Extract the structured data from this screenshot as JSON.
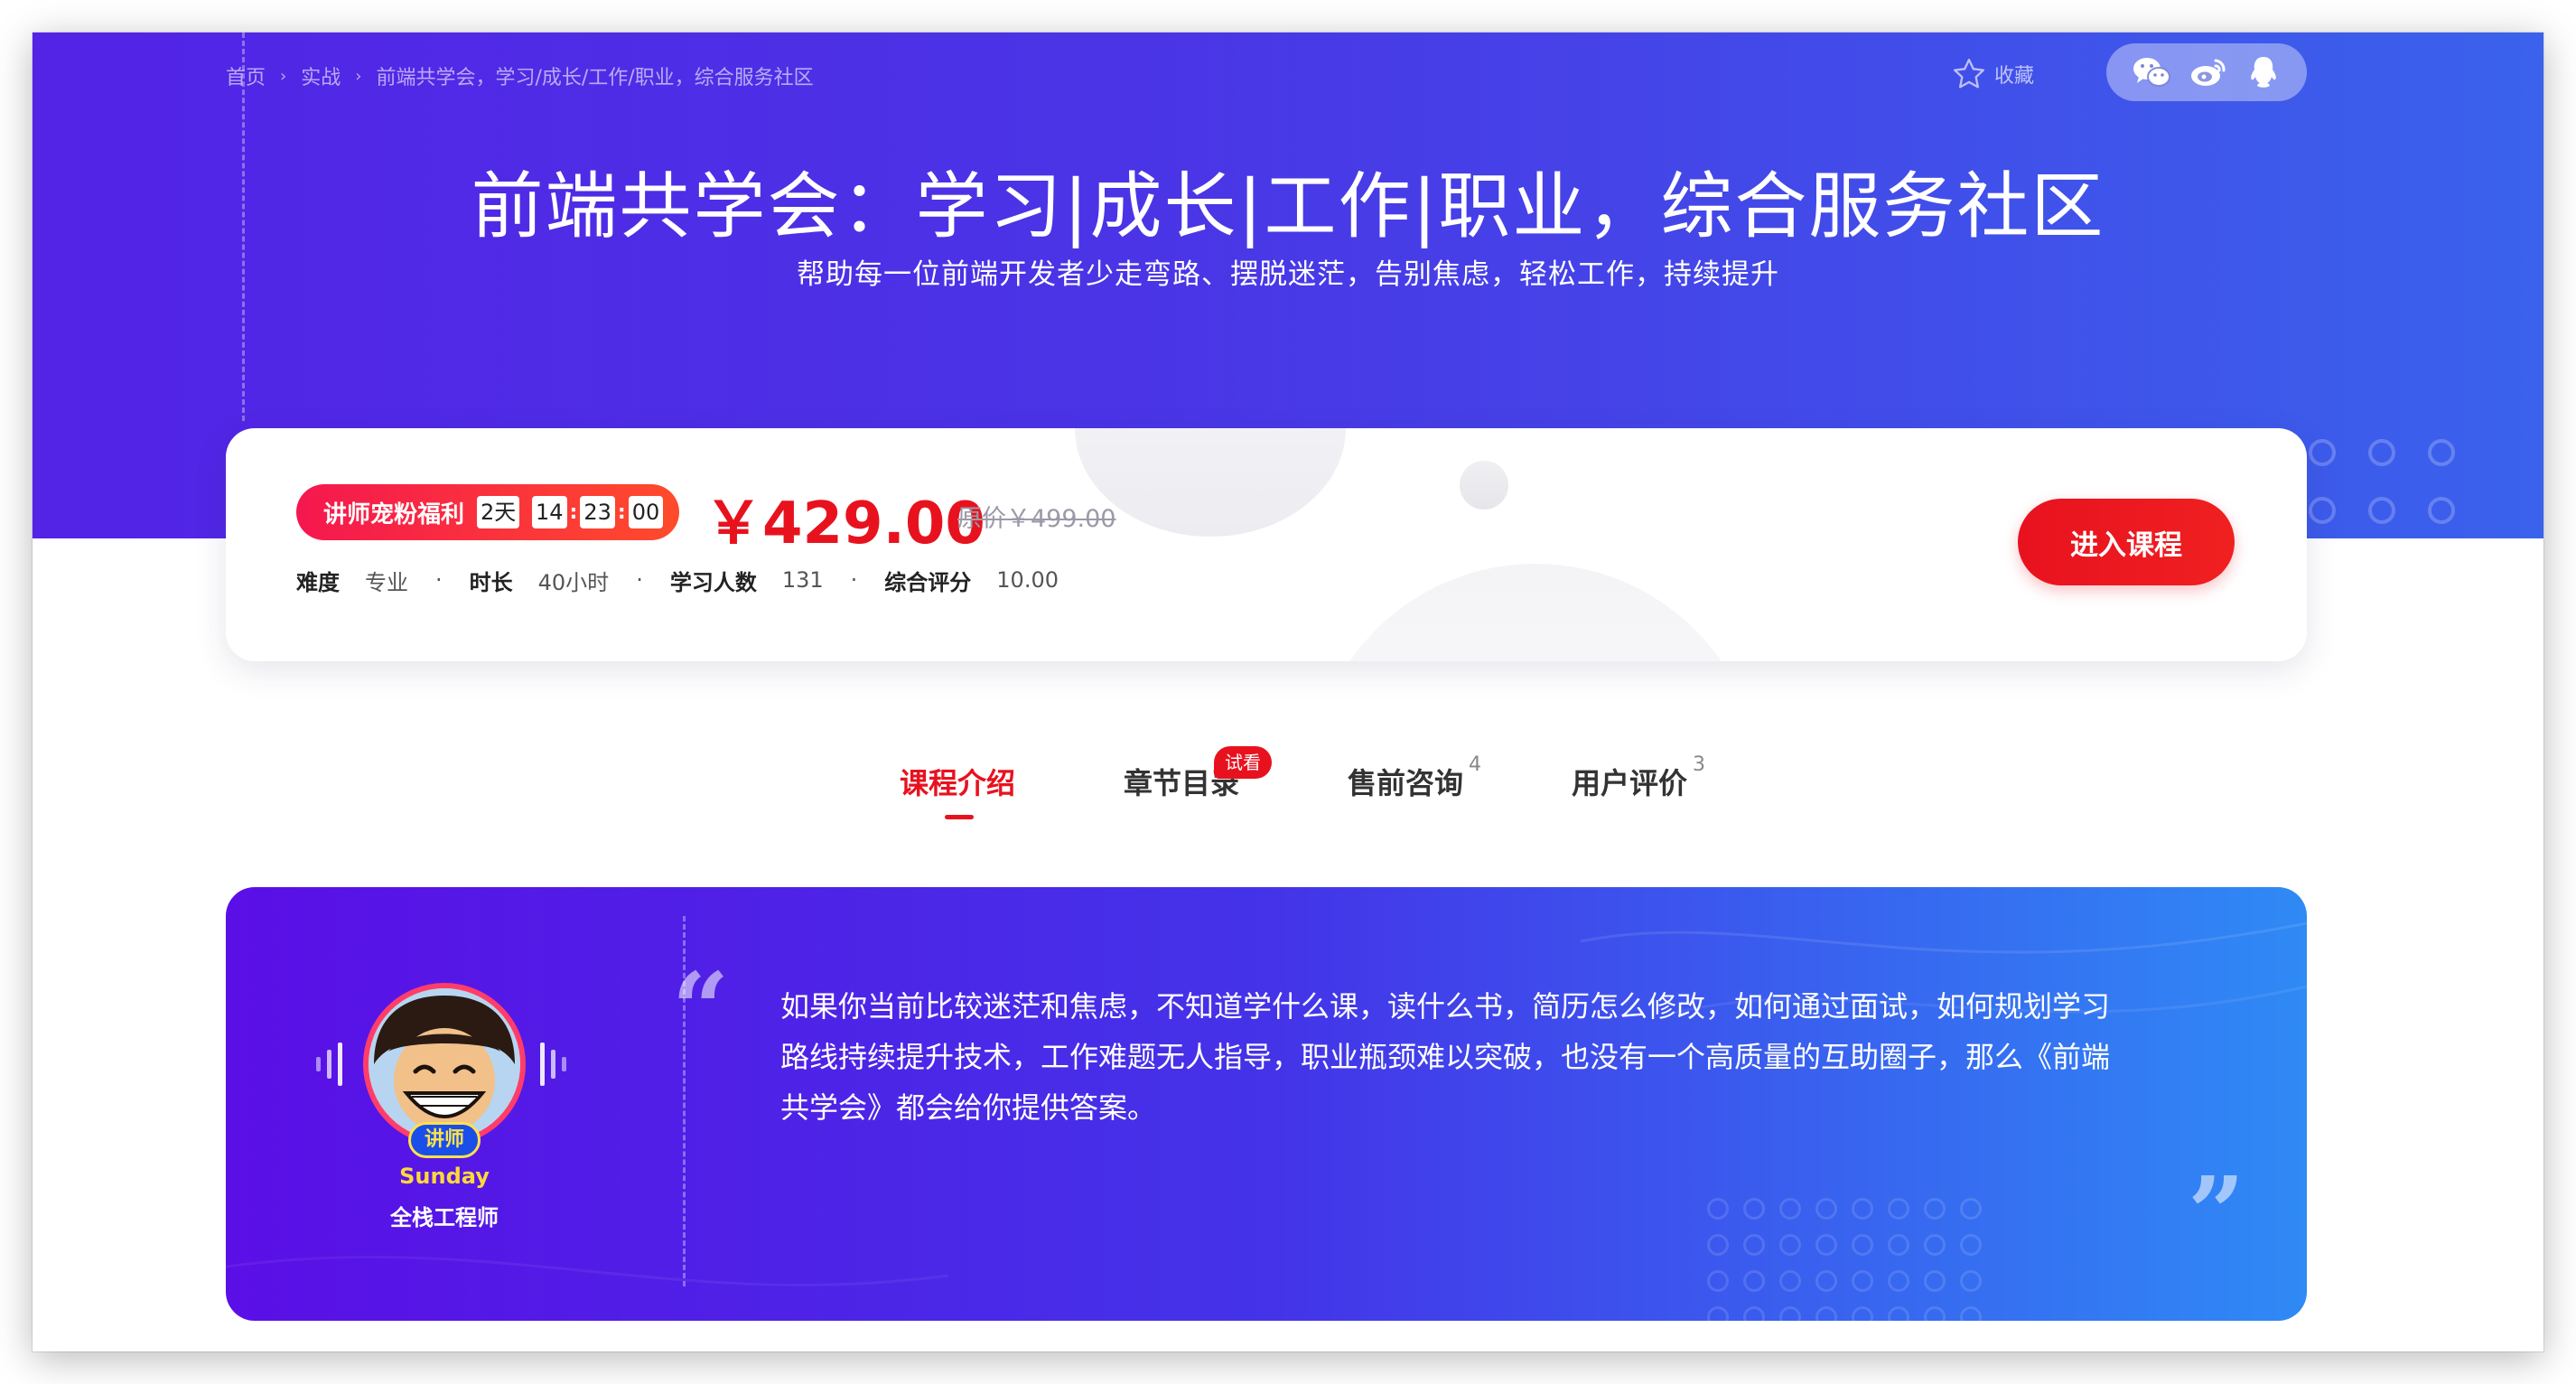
{
  "breadcrumb": {
    "items": [
      "首页",
      "实战",
      "前端共学会，学习/成长/工作/职业，综合服务社区"
    ],
    "separator": "›"
  },
  "header": {
    "favorite_label": "收藏",
    "share_icons": [
      "wechat-icon",
      "weibo-icon",
      "qq-icon"
    ],
    "title": "前端共学会：学习|成长|工作|职业，综合服务社区",
    "subtitle": "帮助每一位前端开发者少走弯路、摆脱迷茫，告别焦虑，轻松工作，持续提升"
  },
  "course_card": {
    "promo_label": "讲师宠粉福利",
    "countdown": {
      "days": "2天",
      "hours": "14",
      "minutes": "23",
      "seconds": "00"
    },
    "price": "￥429.00",
    "original_price": "原价￥499.00",
    "meta": [
      {
        "key": "难度",
        "value": "专业"
      },
      {
        "key": "时长",
        "value": "40小时"
      },
      {
        "key": "学习人数",
        "value": "131"
      },
      {
        "key": "综合评分",
        "value": "10.00"
      }
    ],
    "meta_separator": "·",
    "enroll_button": "进入课程"
  },
  "tabs": [
    {
      "label": "课程介绍",
      "active": true
    },
    {
      "label": "章节目录",
      "badge": "试看"
    },
    {
      "label": "售前咨询",
      "count": "4"
    },
    {
      "label": "用户评价",
      "count": "3"
    }
  ],
  "intro": {
    "teacher_tag": "讲师",
    "teacher_name": "Sunday",
    "teacher_role": "全栈工程师",
    "quote_open": "“",
    "quote_close": "”",
    "quote_text": "如果你当前比较迷茫和焦虑，不知道学什么课，读什么书，简历怎么修改，如何通过面试，如何规划学习路线持续提升技术，工作难题无人指导，职业瓶颈难以突破，也没有一个高质量的互助圈子，那么《前端共学会》都会给你提供答案。"
  },
  "colors": {
    "hero_gradient": [
      "#5323e6",
      "#3a62ec"
    ],
    "accent_red": "#e8121f",
    "intro_gradient": [
      "#5a0fe6",
      "#2f8af5"
    ]
  }
}
